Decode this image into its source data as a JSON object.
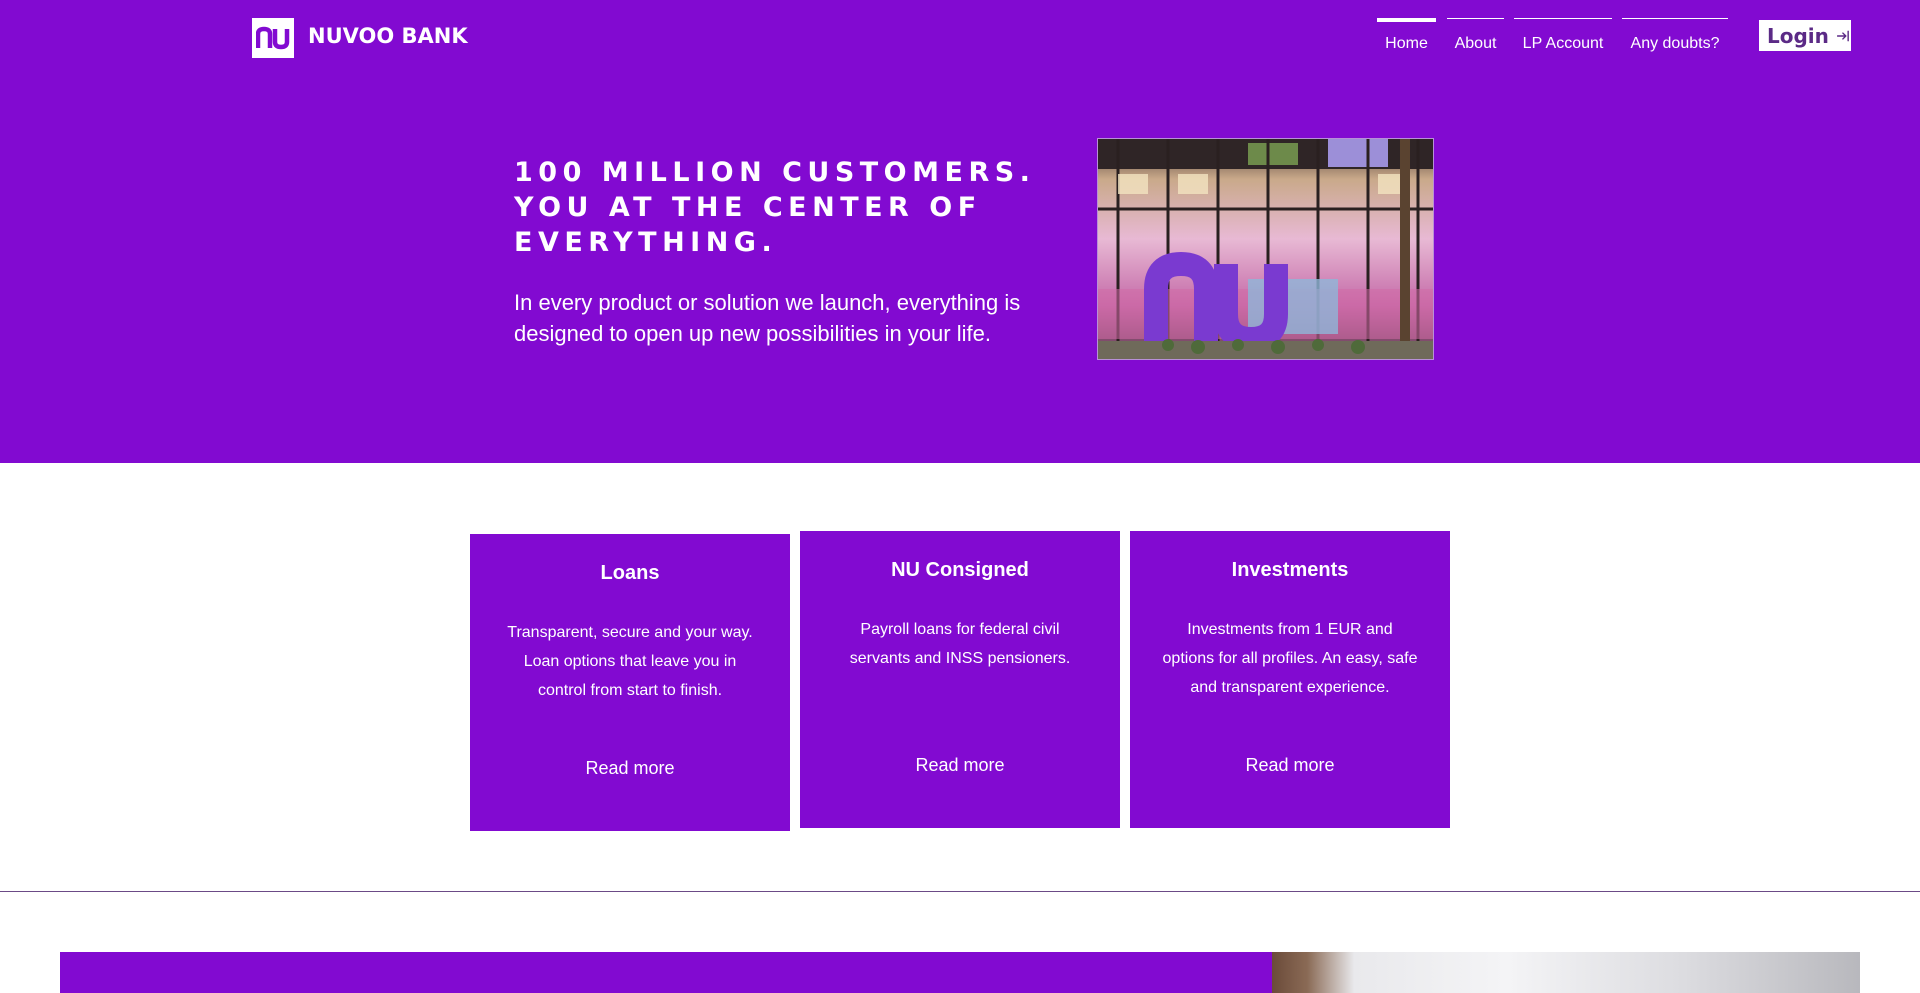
{
  "header": {
    "logo_text": "nu",
    "brand_name": "NUVOO BANK",
    "nav": [
      {
        "label": "Home",
        "active": true
      },
      {
        "label": "About",
        "active": false
      },
      {
        "label": "LP Account",
        "active": false
      },
      {
        "label": "Any doubts?",
        "active": false
      }
    ],
    "login_label": "Login",
    "login_icon": "arrow-right-to-bracket-icon"
  },
  "hero": {
    "title": "100 MILLION CUSTOMERS. YOU AT THE CENTER OF EVERYTHING.",
    "text": "In every product or solution we launch, everything is designed to open up new possibilities in your life.",
    "image_sign_text": "nu"
  },
  "cards": [
    {
      "title": "Loans",
      "description": "Transparent, secure and your way. Loan options that leave you in control from start to finish.",
      "link": "Read more"
    },
    {
      "title": "NU Consigned",
      "description": "Payroll loans for federal civil servants and INSS pensioners.",
      "link": "Read more"
    },
    {
      "title": "Investments",
      "description": "Investments from 1 EUR and options for all profiles. An easy, safe and transparent experience.",
      "link": "Read more"
    }
  ],
  "colors": {
    "brand_purple": "#820ad1",
    "white": "#ffffff"
  }
}
